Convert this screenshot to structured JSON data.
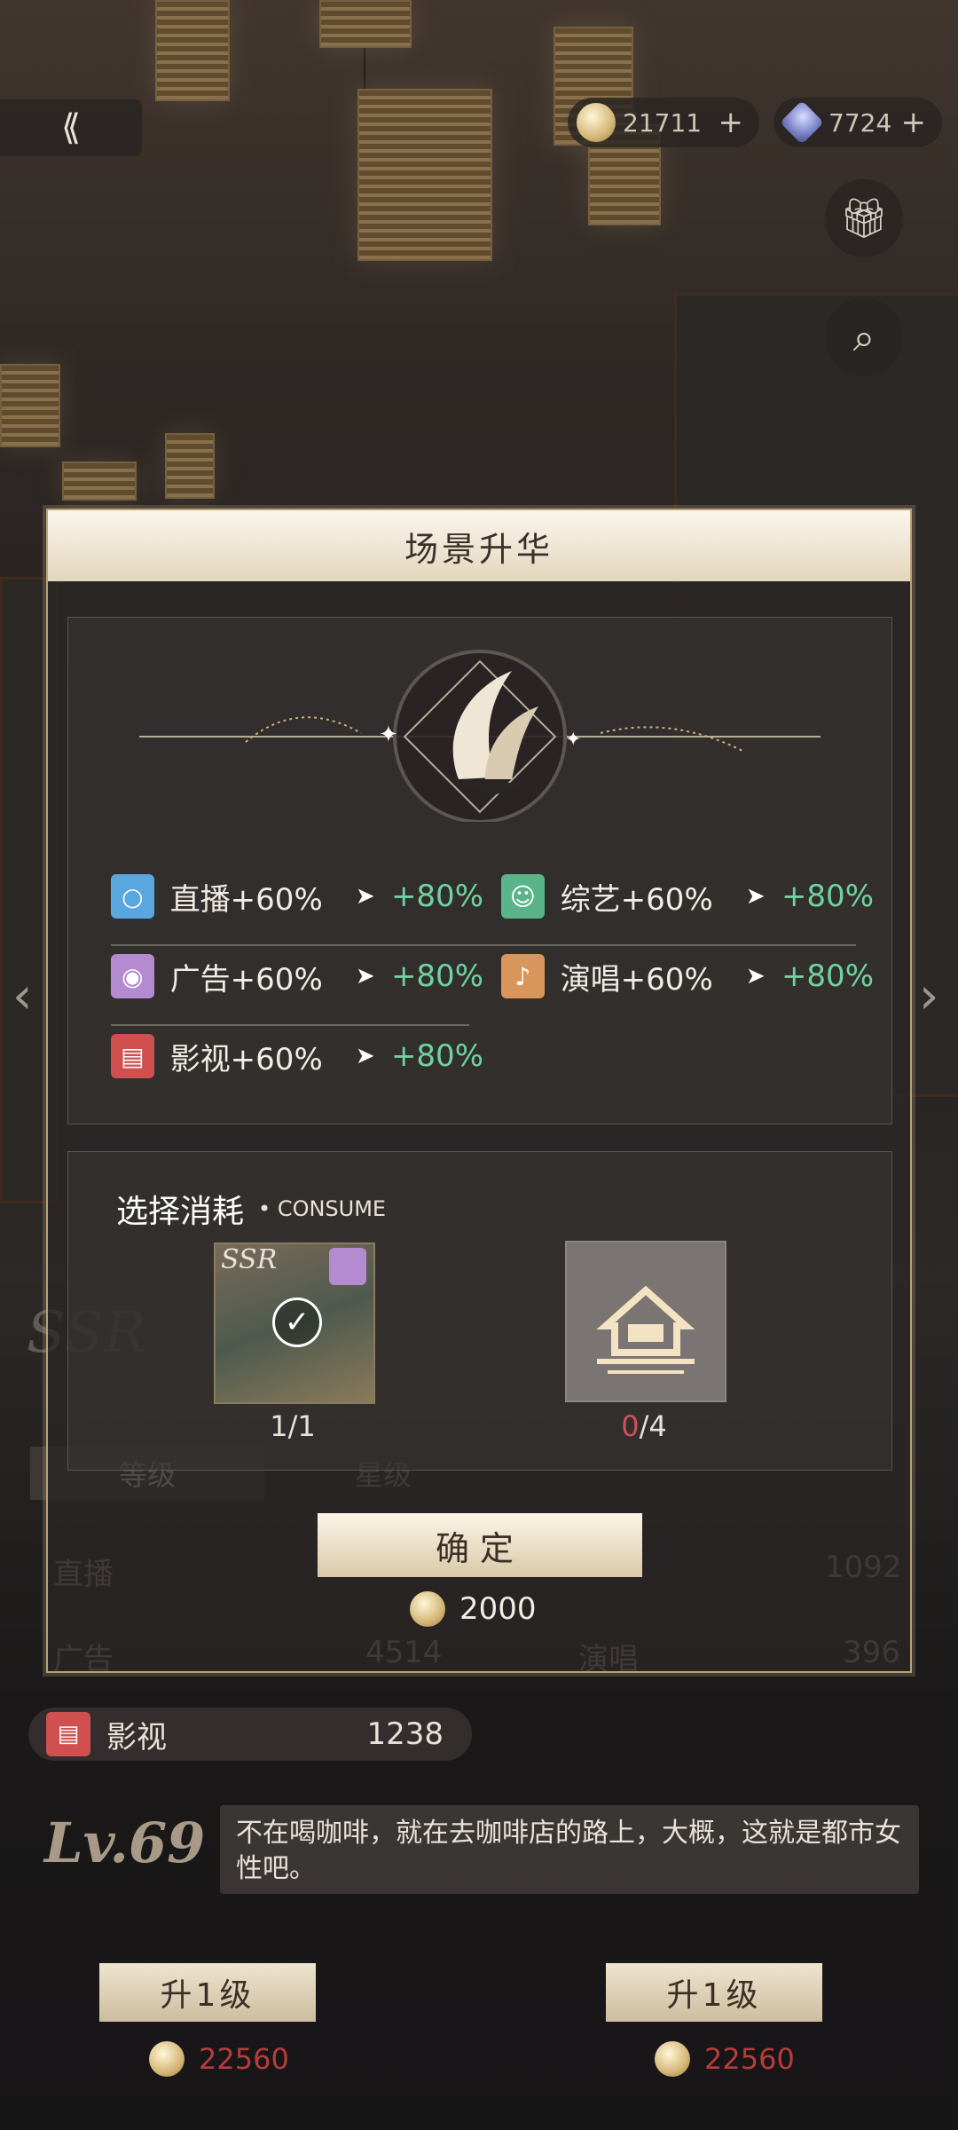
{
  "topbar": {
    "gold": "21711",
    "gems": "7724",
    "plus": "+"
  },
  "background": {
    "stats": [
      {
        "label": "直播",
        "value": "1092"
      },
      {
        "label": "广告",
        "value": "4514"
      },
      {
        "label": "演唱",
        "value": "396"
      },
      {
        "label": "影视",
        "value": "1238"
      }
    ],
    "tabs": {
      "grade": "等级",
      "star": "星级"
    },
    "watermark": "SSR",
    "level": "Lv.69",
    "description": "不在喝咖啡，就在去咖啡店的路上，大概，这就是都市女性吧。",
    "upgrade_buttons": [
      {
        "label": "升1级",
        "cost": "22560"
      },
      {
        "label": "升1级",
        "cost": "22560"
      }
    ]
  },
  "modal": {
    "title": "场景升华",
    "bonuses": [
      {
        "label": "直播+60%",
        "new": "+80%",
        "color": "#5aa7e0",
        "icon": "microphone-icon"
      },
      {
        "label": "综艺+60%",
        "new": "+80%",
        "color": "#5ab48a",
        "icon": "smile-icon"
      },
      {
        "label": "广告+60%",
        "new": "+80%",
        "color": "#b48ad0",
        "icon": "lens-icon"
      },
      {
        "label": "演唱+60%",
        "new": "+80%",
        "color": "#d8965a",
        "icon": "karaoke-mic-icon"
      },
      {
        "label": "影视+60%",
        "new": "+80%",
        "color": "#d05050",
        "icon": "clapper-icon"
      }
    ],
    "consume": {
      "title": "选择消耗",
      "subtitle": "CONSUME",
      "card_badge": "SSR",
      "items": [
        {
          "have": "1",
          "need": "1"
        },
        {
          "have": "0",
          "need": "4"
        }
      ]
    },
    "confirm_label": "确定",
    "confirm_cost": "2000"
  }
}
